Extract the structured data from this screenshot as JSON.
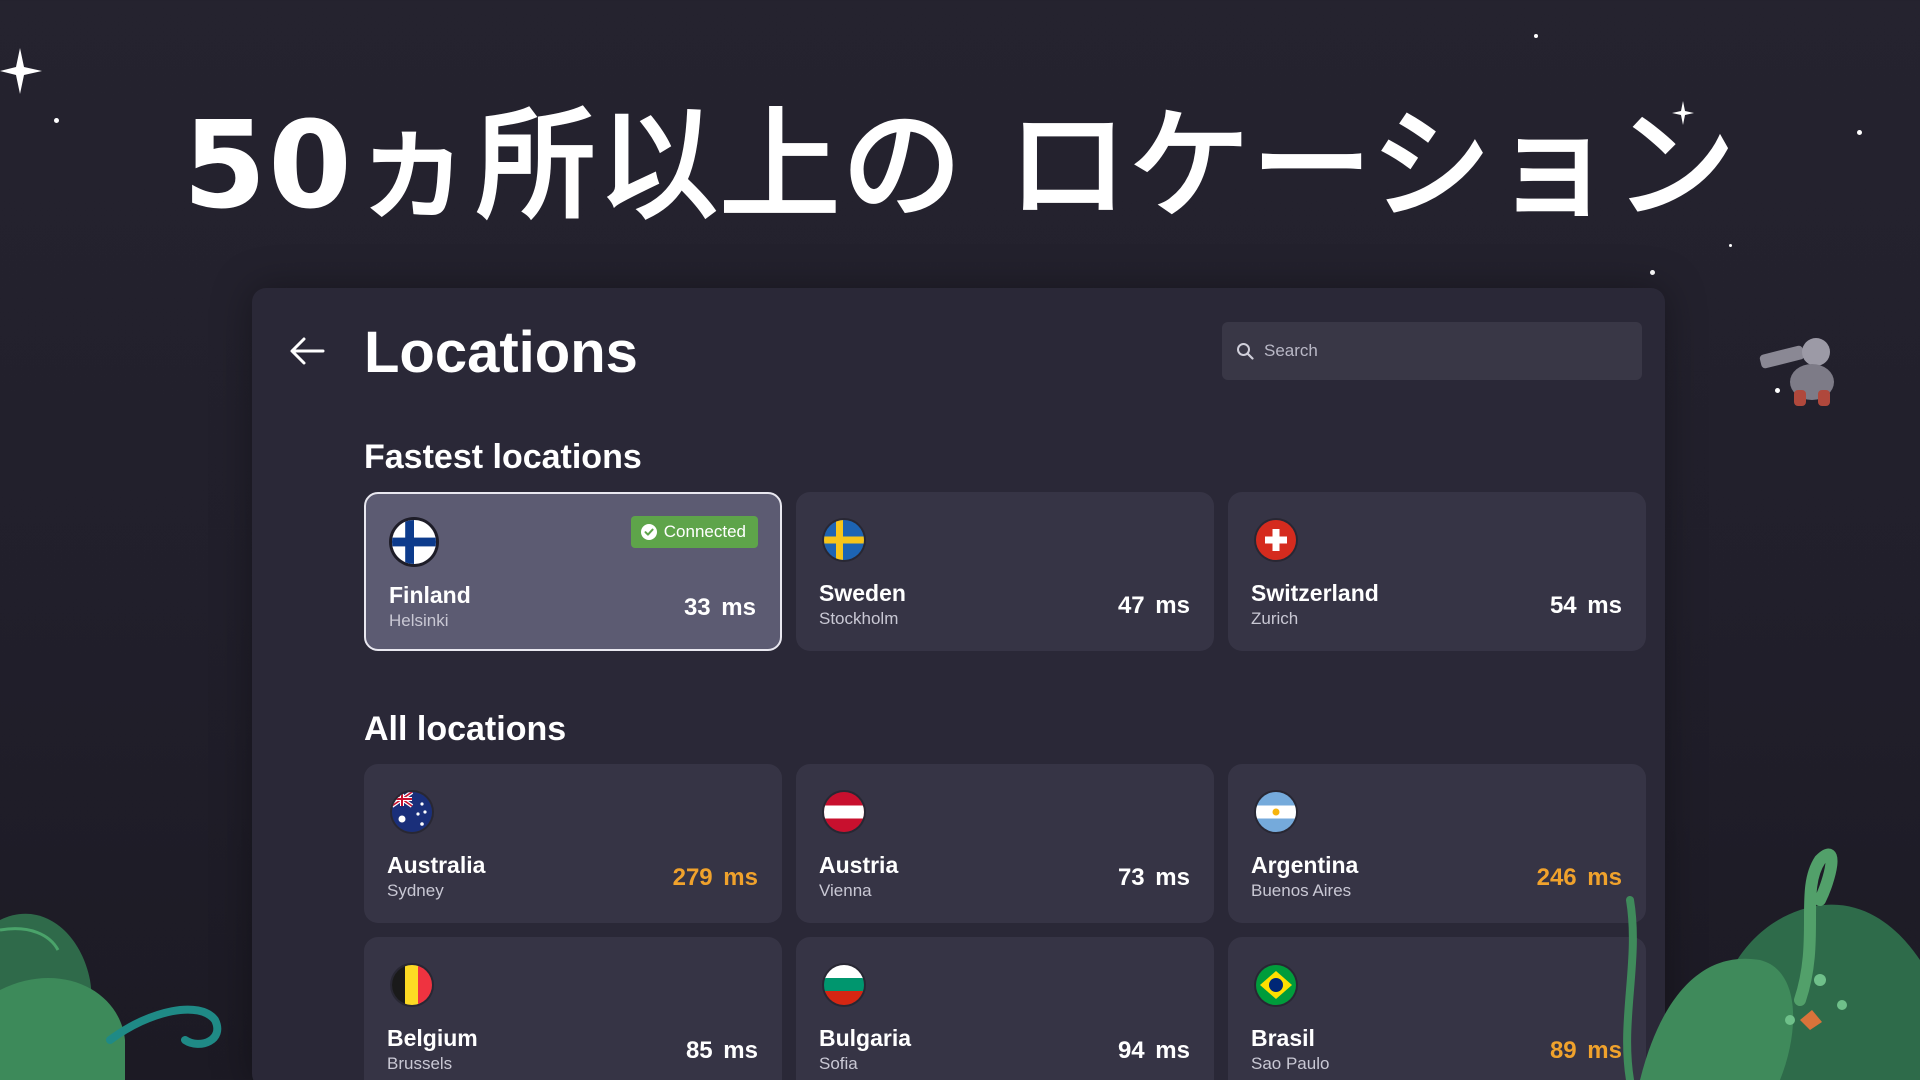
{
  "headline": "50ヵ所以上の ロケーション",
  "screen": {
    "title": "Locations",
    "search_placeholder": "Search"
  },
  "fastest": {
    "title": "Fastest locations",
    "items": [
      {
        "country": "Finland",
        "city": "Helsinki",
        "latency": "33  ms",
        "flag": "finland-flag-icon",
        "selected": true,
        "badge": "Connected"
      },
      {
        "country": "Sweden",
        "city": "Stockholm",
        "latency": "47 ms",
        "flag": "sweden-flag-icon"
      },
      {
        "country": "Switzerland",
        "city": "Zurich",
        "latency": "54  ms",
        "flag": "switzerland-flag-icon"
      }
    ]
  },
  "all": {
    "title": "All locations",
    "items": [
      {
        "country": "Australia",
        "city": "Sydney",
        "latency": "279  ms",
        "flag": "australia-flag-icon",
        "slow": true
      },
      {
        "country": "Austria",
        "city": "Vienna",
        "latency": "73  ms",
        "flag": "austria-flag-icon"
      },
      {
        "country": "Argentina",
        "city": "Buenos Aires",
        "latency": "246  ms",
        "flag": "argentina-flag-icon",
        "slow": true
      },
      {
        "country": "Belgium",
        "city": "Brussels",
        "latency": "85  ms",
        "flag": "belgium-flag-icon"
      },
      {
        "country": "Bulgaria",
        "city": "Sofia",
        "latency": "94  ms",
        "flag": "bulgaria-flag-icon"
      },
      {
        "country": "Brasil",
        "city": "Sao Paulo",
        "latency": "89  ms",
        "flag": "brazil-flag-icon",
        "slow": true
      }
    ]
  },
  "colors": {
    "background": "#25232f",
    "panel": "#2a2837",
    "card": "#363445",
    "card_selected": "#5c5b72",
    "connected_badge": "#5ea44a",
    "slow_latency": "#f0a22c"
  }
}
